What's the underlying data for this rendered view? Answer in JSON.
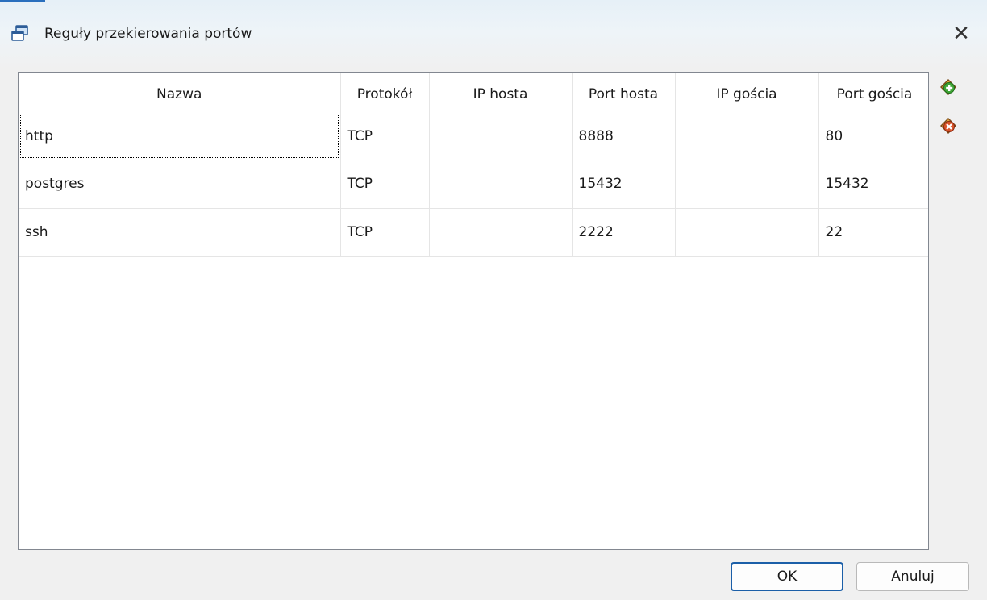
{
  "window": {
    "title": "Reguły przekierowania portów",
    "close_symbol": "✕"
  },
  "icons": {
    "app": "port-forwarding-window-icon",
    "add": "add-rule-icon",
    "remove": "remove-rule-icon",
    "close": "close-icon"
  },
  "colors": {
    "accent": "#1b5fa8",
    "add_icon": "#3fa535",
    "remove_icon": "#d9542b"
  },
  "table": {
    "columns": [
      "Nazwa",
      "Protokół",
      "IP hosta",
      "Port hosta",
      "IP gościa",
      "Port gościa"
    ],
    "rows": [
      [
        "http",
        "TCP",
        "",
        "8888",
        "",
        "80"
      ],
      [
        "postgres",
        "TCP",
        "",
        "15432",
        "",
        "15432"
      ],
      [
        "ssh",
        "TCP",
        "",
        "2222",
        "",
        "22"
      ]
    ]
  },
  "buttons": {
    "ok": "OK",
    "cancel": "Anuluj"
  }
}
